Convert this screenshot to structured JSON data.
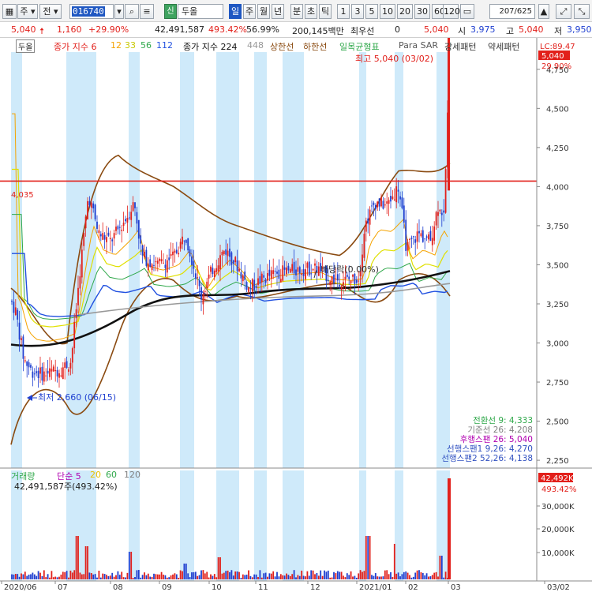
{
  "toolbar": {
    "type_label": "주",
    "market_label": "전",
    "code": "016740",
    "new_badge": "신",
    "stock_name": "두올",
    "periods": [
      "일",
      "주",
      "월",
      "년",
      "분",
      "초",
      "틱"
    ],
    "active_period": "일",
    "intervals": [
      "1",
      "3",
      "5",
      "10",
      "20",
      "30",
      "60",
      "120"
    ],
    "page_count": "207/625"
  },
  "info": {
    "price": "5,040",
    "change": "1,160",
    "change_pct": "+29.90%",
    "volume": "42,491,587",
    "vol_ratio": "493.42%",
    "turnover": "56.99%",
    "amount": "200,145백만",
    "preferred_label": "최우선",
    "preferred_value": "0",
    "bid": "5,040",
    "open_label": "시",
    "open": "3,975",
    "high_label": "고",
    "high": "5,040",
    "low_label": "저",
    "low": "3,950"
  },
  "legend": {
    "stock": "두올",
    "ma_label": "종가 지수 6",
    "ma": [
      "12",
      "33",
      "56",
      "112"
    ],
    "ma_colors": [
      "#f5a300",
      "#c8c800",
      "#2fa84a",
      "#2050e0"
    ],
    "ma2": "종가 지수 224",
    "ma3": "448",
    "upper": "상한선",
    "lower": "하한선",
    "ichimoku": "일목균형표",
    "sar": "Para SAR",
    "strong": "강세패턴",
    "weak": "약세패턴"
  },
  "price_axis": {
    "ticks": [
      "4,750",
      "4,500",
      "4,250",
      "4,000",
      "3,750",
      "3,500",
      "3,250",
      "3,000",
      "2,750",
      "2,500",
      "2,250"
    ],
    "lc": "LC:89.47",
    "last": "5,040",
    "last_pct": "29.90%"
  },
  "annotations": {
    "high_note": "최고 5,040 (03/02)",
    "low_note": "최저 2,660 (06/15)",
    "resistance": "4,035",
    "dividend": "배당락(0.00%)"
  },
  "ichimoku_values": [
    {
      "text": "전환선 9: 4,333",
      "color": "#2fa84a"
    },
    {
      "text": "기준선 26: 4,208",
      "color": "#808080"
    },
    {
      "text": "후행스팬 26: 5,040",
      "color": "#b000b0"
    },
    {
      "text": "선행스팬1 9,26: 4,270",
      "color": "#3050c0"
    },
    {
      "text": "선행스팬2 52,26: 4,138",
      "color": "#3050c0"
    }
  ],
  "volume_panel": {
    "title": "거래량",
    "ma_label": "단순 5",
    "ma": [
      "20",
      "60",
      "120"
    ],
    "ma_colors": [
      "#e8c000",
      "#2fa84a",
      "#808080"
    ],
    "value": "42,491,587주(493.42%)",
    "ticks": [
      "30,000K",
      "20,000K",
      "10,000K"
    ],
    "last": "42,492K",
    "last_pct": "493.42%"
  },
  "x_axis": {
    "labels": [
      "2020/06",
      "07",
      "08",
      "09",
      "10",
      "11",
      "12",
      "2021/01",
      "02",
      "03",
      "03/02"
    ]
  },
  "chart_data": {
    "type": "candlestick",
    "resistance_level": 4035,
    "high": {
      "value": 5040,
      "date": "03/02"
    },
    "low": {
      "value": 2660,
      "date": "06/15"
    },
    "ylim": [
      2200,
      4850
    ],
    "last_close": 5040,
    "last_volume_k": 42492
  }
}
